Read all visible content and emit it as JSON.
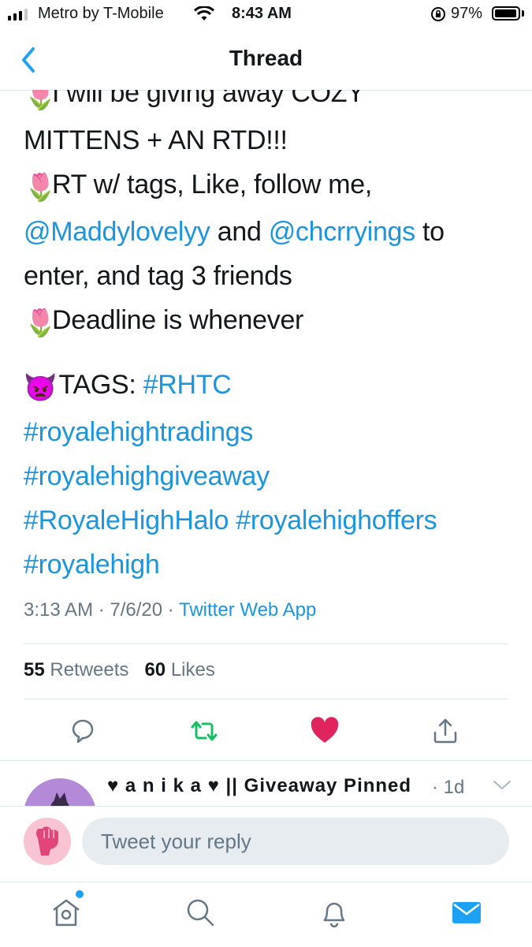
{
  "status_bar": {
    "carrier": "Metro by T-Mobile",
    "time": "8:43 AM",
    "battery": "97%",
    "battery_level": 0.97
  },
  "header": {
    "title": "Thread",
    "back_icon": "chevron-left-icon"
  },
  "tweet": {
    "lines": {
      "l1": "I will be giving away COZY",
      "l2": "MITTENS + AN RTD!!!",
      "l3": "RT w/ tags, Like, follow me,",
      "l4_mention1": "@Maddylovelyy",
      "l4_and": " and ",
      "l4_mention2": "@chcrryings",
      "l4_end": " to",
      "l5": "enter, and tag 3 friends",
      "l6": "Deadline is whenever",
      "l7_text": " TAGS: ",
      "l7_tag": "#RHTC",
      "l8": "#royalehightradings",
      "l9": "#royalehighgiveaway",
      "l10_tag1": "#RoyaleHighHalo",
      "l10_tag2": "#royalehighoffers",
      "l11": "#royalehigh"
    },
    "emoji": {
      "tulip": "🌷",
      "devil": "👿"
    },
    "timestamp": "3:13 AM · 7/6/20 · ",
    "source": "Twitter Web App",
    "retweet_count": "55",
    "retweet_label": "Retweets",
    "like_count": "60",
    "like_label": "Likes"
  },
  "actions": {
    "reply_icon": "comment-icon",
    "retweet_icon": "retweet-icon",
    "like_icon": "heart-icon",
    "share_icon": "share-icon",
    "retweet_color": "#17bf63",
    "like_color": "#e0245e"
  },
  "reply_preview": {
    "name": "♥ a n i k a ♥ || Giveaway Pinned",
    "time": "· 1d"
  },
  "composer": {
    "placeholder": "Tweet your reply"
  },
  "tabbar": {
    "items": [
      "home-icon",
      "search-icon",
      "notifications-icon",
      "messages-icon"
    ],
    "accent": "#1da1f2"
  }
}
